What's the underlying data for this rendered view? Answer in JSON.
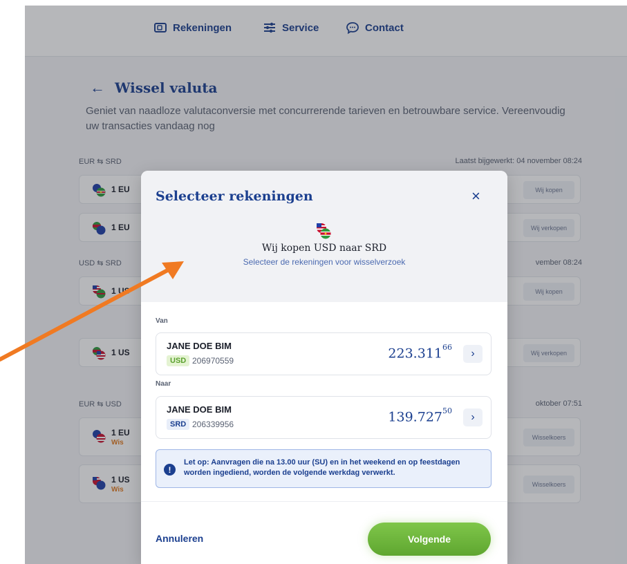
{
  "nav": {
    "items": [
      {
        "label": "Rekeningen",
        "icon": "wallet-icon"
      },
      {
        "label": "Service",
        "icon": "sliders-icon"
      },
      {
        "label": "Contact",
        "icon": "chat-icon"
      }
    ]
  },
  "page": {
    "back_icon": "←",
    "title": "Wissel valuta",
    "subtitle": "Geniet van naadloze valutaconversie met concurrerende tarieven en betrouwbare service. Vereenvoudig uw transacties vandaag nog"
  },
  "groups": [
    {
      "pair": "EUR ⇆ SRD",
      "updated": "Laatst bijgewerkt: 04 november 08:24"
    },
    {
      "pair": "USD ⇆ SRD",
      "updated": "vember 08:24"
    },
    {
      "pair": "EUR ⇆ USD",
      "updated": "oktober 07:51"
    }
  ],
  "rate_cards": [
    {
      "text": "1 EU",
      "sub": "",
      "button": "Wij kopen"
    },
    {
      "text": "1 EU",
      "sub": "",
      "button": "Wij verkopen"
    },
    {
      "text": "1 US",
      "sub": "",
      "button": "Wij kopen"
    },
    {
      "text": "1 US",
      "sub": "",
      "button": "Wij verkopen"
    },
    {
      "text": "1 EU",
      "sub": "Wis",
      "button": "Wisselkoers"
    },
    {
      "text": "1 US",
      "sub": "Wis",
      "button": "Wisselkoers"
    }
  ],
  "modal": {
    "title": "Selecteer rekeningen",
    "close_icon": "×",
    "heading": "Wij kopen USD naar SRD",
    "subheading": "Selecteer de rekeningen voor wisselverzoek",
    "from_label": "Van",
    "to_label": "Naar",
    "from_account": {
      "name": "JANE DOE BIM",
      "currency": "USD",
      "number": "206970559",
      "amount_main": "223.311",
      "amount_cents": "66"
    },
    "to_account": {
      "name": "JANE DOE BIM",
      "currency": "SRD",
      "number": "206339956",
      "amount_main": "139.727",
      "amount_cents": "50"
    },
    "chevron": "›",
    "notice_icon": "!",
    "notice": "Let op: Aanvragen die na 13.00 uur (SU) en in het weekend en op feestdagen worden ingediend, worden de volgende werkdag verwerkt.",
    "cancel_label": "Annuleren",
    "next_label": "Volgende"
  },
  "colors": {
    "brand": "#1b3f8f",
    "accent_green": "#6cb43a",
    "arrow_orange": "#f07a22",
    "usd_badge_bg": "#e4f3d2",
    "usd_badge_fg": "#5ba12e",
    "srd_badge_bg": "#e8eef9",
    "srd_badge_fg": "#1b3f8f"
  }
}
